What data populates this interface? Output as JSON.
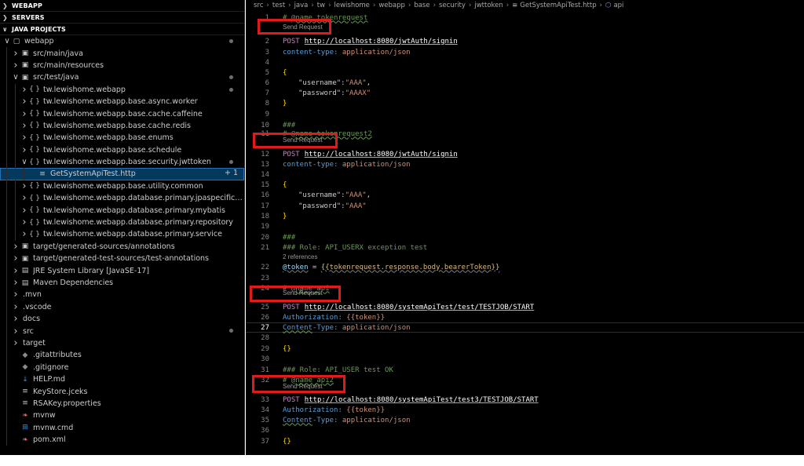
{
  "sidebar": {
    "sections": {
      "webapp": "WEBAPP",
      "servers": "SERVERS",
      "java_projects": "JAVA PROJECTS"
    },
    "tree": [
      {
        "label": "webapp",
        "depth": 0,
        "twisty": "open",
        "icon": "folder-outline-icon",
        "dot": true
      },
      {
        "label": "src/main/java",
        "depth": 1,
        "twisty": "closed",
        "icon": "source-folder-icon"
      },
      {
        "label": "src/main/resources",
        "depth": 1,
        "twisty": "closed",
        "icon": "source-folder-icon"
      },
      {
        "label": "src/test/java",
        "depth": 1,
        "twisty": "open",
        "icon": "source-folder-icon",
        "dot": true
      },
      {
        "label": "tw.lewishome.webapp",
        "depth": 2,
        "twisty": "closed",
        "icon": "package-icon",
        "dot": true
      },
      {
        "label": "tw.lewishome.webapp.base.async.worker",
        "depth": 2,
        "twisty": "closed",
        "icon": "package-icon"
      },
      {
        "label": "tw.lewishome.webapp.base.cache.caffeine",
        "depth": 2,
        "twisty": "closed",
        "icon": "package-icon"
      },
      {
        "label": "tw.lewishome.webapp.base.cache.redis",
        "depth": 2,
        "twisty": "closed",
        "icon": "package-icon"
      },
      {
        "label": "tw.lewishome.webapp.base.enums",
        "depth": 2,
        "twisty": "closed",
        "icon": "package-icon"
      },
      {
        "label": "tw.lewishome.webapp.base.schedule",
        "depth": 2,
        "twisty": "closed",
        "icon": "package-icon"
      },
      {
        "label": "tw.lewishome.webapp.base.security.jwttoken",
        "depth": 2,
        "twisty": "open",
        "icon": "package-icon",
        "dot": true
      },
      {
        "label": "GetSystemApiTest.http",
        "depth": 3,
        "twisty": "none",
        "icon": "http-file-icon",
        "selected": true,
        "badge": "+ 1"
      },
      {
        "label": "tw.lewishome.webapp.base.utility.common",
        "depth": 2,
        "twisty": "closed",
        "icon": "package-icon"
      },
      {
        "label": "tw.lewishome.webapp.database.primary.jpaspecification",
        "depth": 2,
        "twisty": "closed",
        "icon": "package-icon"
      },
      {
        "label": "tw.lewishome.webapp.database.primary.mybatis",
        "depth": 2,
        "twisty": "closed",
        "icon": "package-icon"
      },
      {
        "label": "tw.lewishome.webapp.database.primary.repository",
        "depth": 2,
        "twisty": "closed",
        "icon": "package-icon"
      },
      {
        "label": "tw.lewishome.webapp.database.primary.service",
        "depth": 2,
        "twisty": "closed",
        "icon": "package-icon"
      },
      {
        "label": "target/generated-sources/annotations",
        "depth": 1,
        "twisty": "closed",
        "icon": "source-folder-icon"
      },
      {
        "label": "target/generated-test-sources/test-annotations",
        "depth": 1,
        "twisty": "closed",
        "icon": "source-folder-icon"
      },
      {
        "label": "JRE System Library [JavaSE-17]",
        "depth": 1,
        "twisty": "closed",
        "icon": "library-icon"
      },
      {
        "label": "Maven Dependencies",
        "depth": 1,
        "twisty": "closed",
        "icon": "library-icon"
      },
      {
        "label": ".mvn",
        "depth": 1,
        "twisty": "closed",
        "icon": "none"
      },
      {
        "label": ".vscode",
        "depth": 1,
        "twisty": "closed",
        "icon": "none"
      },
      {
        "label": "docs",
        "depth": 1,
        "twisty": "closed",
        "icon": "none"
      },
      {
        "label": "src",
        "depth": 1,
        "twisty": "closed",
        "icon": "none",
        "dot": true
      },
      {
        "label": "target",
        "depth": 1,
        "twisty": "closed",
        "icon": "none"
      },
      {
        "label": ".gitattributes",
        "depth": 1,
        "twisty": "none",
        "icon": "git-icon"
      },
      {
        "label": ".gitignore",
        "depth": 1,
        "twisty": "none",
        "icon": "git-icon"
      },
      {
        "label": "HELP.md",
        "depth": 1,
        "twisty": "none",
        "icon": "markdown-icon"
      },
      {
        "label": "KeyStore.jceks",
        "depth": 1,
        "twisty": "none",
        "icon": "lines-file-icon"
      },
      {
        "label": "RSAKey.properties",
        "depth": 1,
        "twisty": "none",
        "icon": "lines-file-icon"
      },
      {
        "label": "mvnw",
        "depth": 1,
        "twisty": "none",
        "icon": "pin-icon"
      },
      {
        "label": "mvnw.cmd",
        "depth": 1,
        "twisty": "none",
        "icon": "windows-icon"
      },
      {
        "label": "pom.xml",
        "depth": 1,
        "twisty": "none",
        "icon": "pin-icon"
      }
    ]
  },
  "editor": {
    "breadcrumb": [
      "src",
      "test",
      "java",
      "tw",
      "lewishome",
      "webapp",
      "base",
      "security",
      "jwttoken",
      "GetSystemApiTest.http",
      "api"
    ],
    "codelens": {
      "send_request": "Send Request",
      "references": "2 references"
    },
    "lines": {
      "l1_prefix": "# ",
      "l1_at": "@name",
      "l1_name": " tokenrequest",
      "l2_method": "POST",
      "l2_url": "http://localhost:8080/jwtAuth/signin",
      "l3_key": "content-type:",
      "l3_val": " application/json",
      "l5": "{",
      "l6_key": "\"username\":",
      "l6_val": "\"AAA\"",
      "l6_tail": ",",
      "l7_key": "\"password\":",
      "l7_val": "\"AAAX\"",
      "l8": "}",
      "l10": "###",
      "l11_prefix": "# ",
      "l11_at": "@name",
      "l11_name": " tokenrequest2",
      "l12_method": "POST",
      "l12_url": "http://localhost:8080/jwtAuth/signin",
      "l13_key": "content-type:",
      "l13_val": " application/json",
      "l15": "{",
      "l16_key": "\"username\":",
      "l16_val": "\"AAA\"",
      "l16_tail": ",",
      "l17_key": "\"password\":",
      "l17_val": "\"AAA\"",
      "l18": "}",
      "l20": "###",
      "l21": "### Role: API_USERX exception test",
      "l22_var": "@token",
      "l22_eq": " = ",
      "l22_tmpl": "{{tokenrequest.response.body.bearerToken}}",
      "l24_prefix": "# ",
      "l24_at": "@name",
      "l24_name": " api",
      "l25_method": "POST",
      "l25_url": "http://localhost:8080/systemApiTest/test/TESTJOB/START",
      "l26_key": "Authorization:",
      "l26_val": " {{token}}",
      "l27_key1": "Content",
      "l27_key2": "-Type:",
      "l27_val": " application/json",
      "l29": "{}",
      "l31": "### Role: API_USER test OK",
      "l32_prefix": "# ",
      "l32_at": "@name",
      "l32_name": " api2",
      "l33_method": "POST",
      "l33_url": "http://localhost:8080/systemApiTest/test3/TESTJOB/START",
      "l34_key": "Authorization:",
      "l34_val": " {{token}}",
      "l35_key1": "Content",
      "l35_key2": "-Type:",
      "l35_val": " application/json",
      "l37": "{}"
    }
  },
  "colors": {
    "background": "#000000",
    "highlight_box": "#e01b1b",
    "selection": "#04395e"
  }
}
